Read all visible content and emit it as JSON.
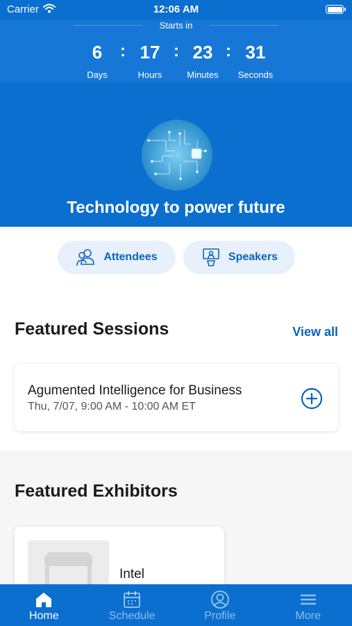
{
  "status_bar": {
    "carrier": "Carrier",
    "time": "12:06 AM"
  },
  "countdown": {
    "heading": "Starts in",
    "units": [
      {
        "value": "6",
        "label": "Days"
      },
      {
        "value": "17",
        "label": "Hours"
      },
      {
        "value": "23",
        "label": "Minutes"
      },
      {
        "value": "31",
        "label": "Seconds"
      }
    ],
    "separator": ":"
  },
  "hero": {
    "title": "Technology to power future",
    "image": "circuit-board-image"
  },
  "quick_links": [
    {
      "label": "Attendees",
      "icon": "attendees-icon"
    },
    {
      "label": "Speakers",
      "icon": "speakers-icon"
    }
  ],
  "featured_sessions": {
    "title": "Featured Sessions",
    "view_all": "View all",
    "sessions": [
      {
        "title": "Agumented Intelligence for Business",
        "time": "Thu, 7/07, 9:00 AM - 10:00 AM ET"
      }
    ]
  },
  "featured_exhibitors": {
    "title": "Featured Exhibitors",
    "exhibitors": [
      {
        "name": "Intel"
      }
    ]
  },
  "tabbar": {
    "items": [
      {
        "label": "Home",
        "icon": "home-icon",
        "active": true
      },
      {
        "label": "Schedule",
        "icon": "calendar-icon"
      },
      {
        "label": "Profile",
        "icon": "profile-icon"
      },
      {
        "label": "More",
        "icon": "menu-icon"
      }
    ]
  },
  "colors": {
    "primary": "#0a6fcf",
    "accent": "#0a63ba",
    "pill_bg": "#e8f1fb"
  }
}
